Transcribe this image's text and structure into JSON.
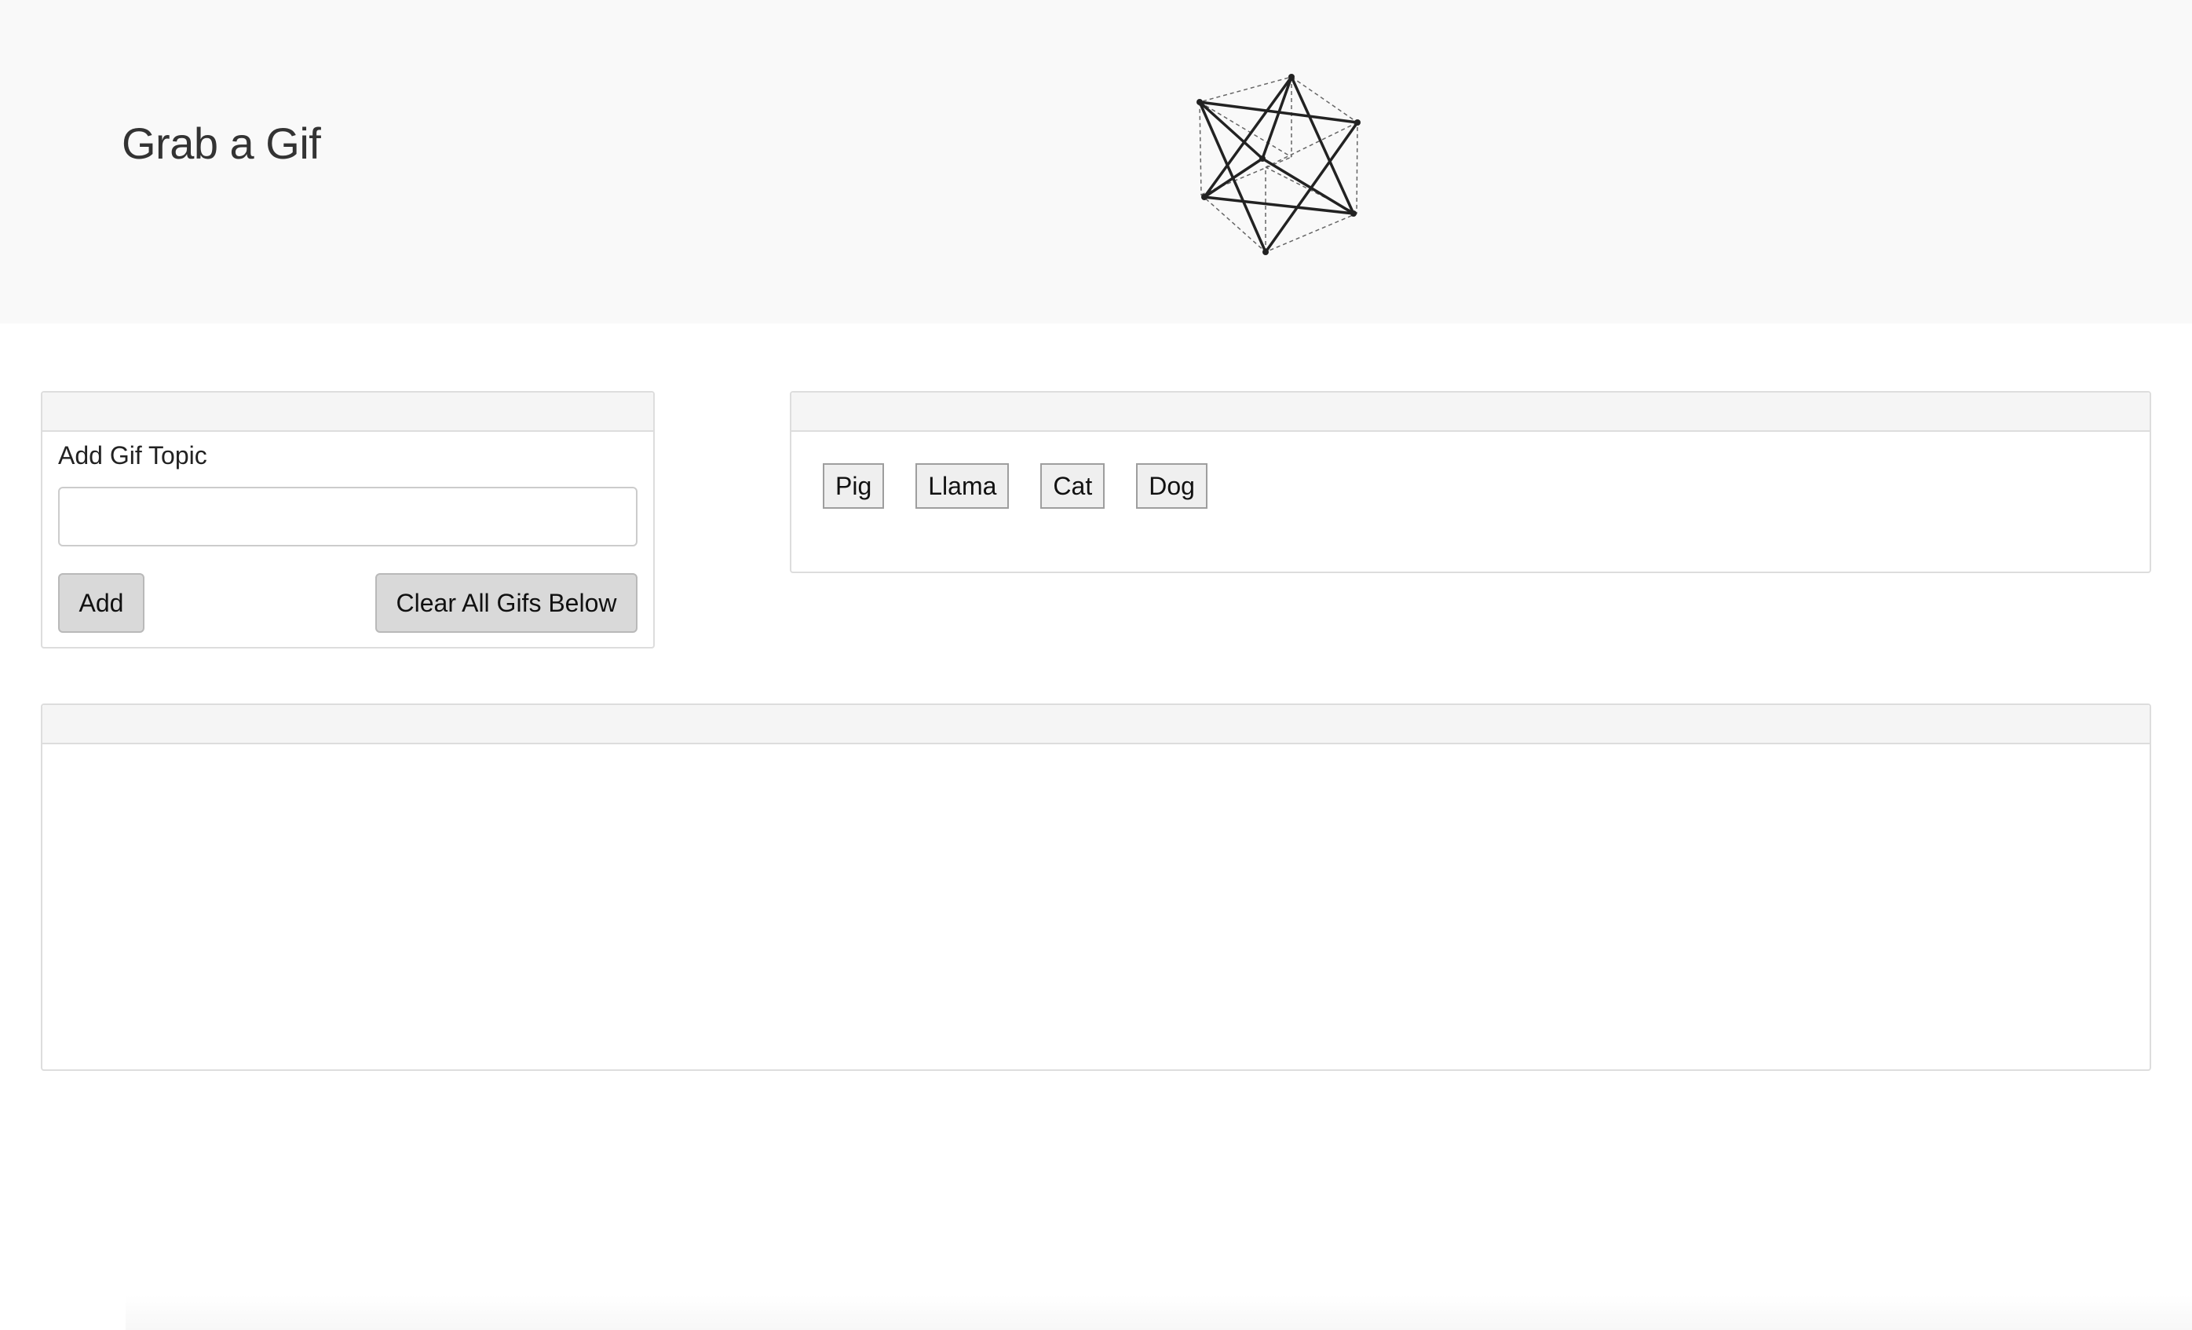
{
  "header": {
    "title": "Grab a Gif",
    "logo_icon": "wireframe-polyhedron-icon"
  },
  "add_panel": {
    "label": "Add Gif Topic",
    "input_value": "",
    "input_placeholder": "",
    "add_label": "Add",
    "clear_label": "Clear All Gifs Below"
  },
  "topics": [
    "Pig",
    "Llama",
    "Cat",
    "Dog"
  ],
  "colors": {
    "jumbotron_bg": "#f9f9f9",
    "panel_heading_bg": "#f5f5f5",
    "panel_border": "#dddddd",
    "button_bg": "#d9d9d9",
    "topic_bg": "#efefef"
  }
}
